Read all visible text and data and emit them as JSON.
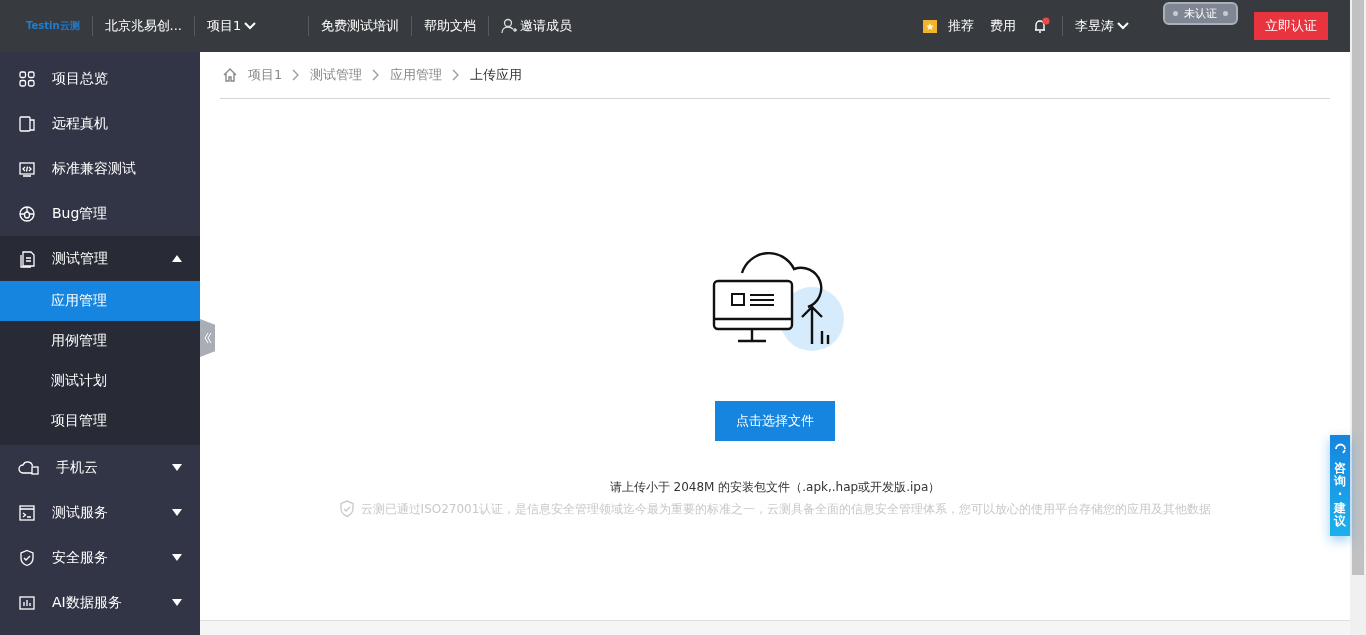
{
  "header": {
    "logo": "Testin云测",
    "org": "北京兆易创...",
    "project": "项目1",
    "links": [
      "免费测试培训",
      "帮助文档"
    ],
    "invite": "邀请成员",
    "recommend": "推荐",
    "fees": "费用",
    "notification_unread": true,
    "user": "李昱涛",
    "cert_status": "未认证",
    "certify_button": "立即认证"
  },
  "sidebar": {
    "items": [
      {
        "label": "项目总览",
        "expanded": false
      },
      {
        "label": "远程真机",
        "expanded": false
      },
      {
        "label": "标准兼容测试",
        "expanded": false
      },
      {
        "label": "Bug管理",
        "expanded": false
      },
      {
        "label": "测试管理",
        "expanded": true,
        "children": [
          {
            "label": "应用管理",
            "selected": true
          },
          {
            "label": "用例管理",
            "selected": false
          },
          {
            "label": "测试计划",
            "selected": false
          },
          {
            "label": "项目管理",
            "selected": false
          }
        ]
      },
      {
        "label": "手机云",
        "expanded": false
      },
      {
        "label": "测试服务",
        "expanded": false
      },
      {
        "label": "安全服务",
        "expanded": false
      },
      {
        "label": "AI数据服务",
        "expanded": false
      }
    ]
  },
  "breadcrumb": [
    "项目1",
    "测试管理",
    "应用管理",
    "上传应用"
  ],
  "upload": {
    "button": "点击选择文件",
    "hint": "请上传小于 2048M 的安装包文件（.apk,.hap或开发版.ipa）",
    "security_note": "云测已通过ISO27001认证，是信息安全管理领域迄今最为重要的标准之一，云测具备全面的信息安全管理体系，您可以放心的使用平台存储您的应用及其他数据"
  },
  "consult_tab": "咨询·建议"
}
